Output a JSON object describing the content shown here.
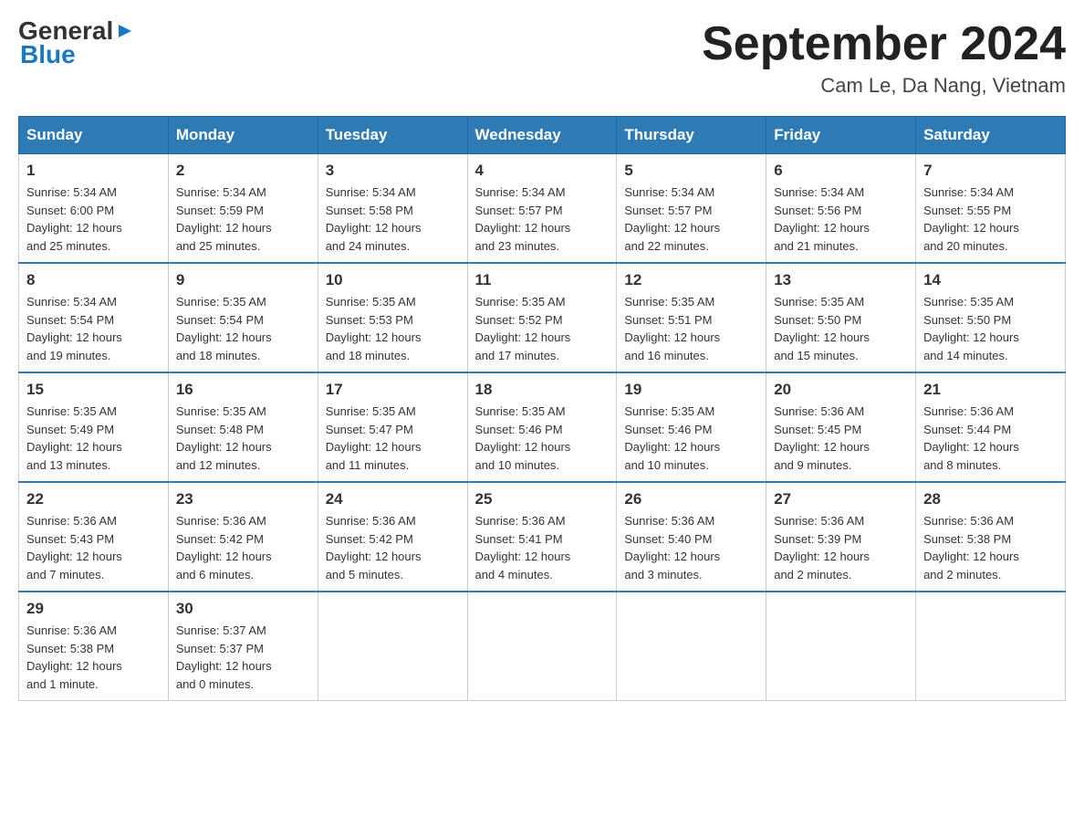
{
  "header": {
    "logo_general": "General",
    "logo_blue": "Blue",
    "month_title": "September 2024",
    "subtitle": "Cam Le, Da Nang, Vietnam"
  },
  "weekdays": [
    "Sunday",
    "Monday",
    "Tuesday",
    "Wednesday",
    "Thursday",
    "Friday",
    "Saturday"
  ],
  "weeks": [
    [
      {
        "day": "1",
        "info": "Sunrise: 5:34 AM\nSunset: 6:00 PM\nDaylight: 12 hours\nand 25 minutes."
      },
      {
        "day": "2",
        "info": "Sunrise: 5:34 AM\nSunset: 5:59 PM\nDaylight: 12 hours\nand 25 minutes."
      },
      {
        "day": "3",
        "info": "Sunrise: 5:34 AM\nSunset: 5:58 PM\nDaylight: 12 hours\nand 24 minutes."
      },
      {
        "day": "4",
        "info": "Sunrise: 5:34 AM\nSunset: 5:57 PM\nDaylight: 12 hours\nand 23 minutes."
      },
      {
        "day": "5",
        "info": "Sunrise: 5:34 AM\nSunset: 5:57 PM\nDaylight: 12 hours\nand 22 minutes."
      },
      {
        "day": "6",
        "info": "Sunrise: 5:34 AM\nSunset: 5:56 PM\nDaylight: 12 hours\nand 21 minutes."
      },
      {
        "day": "7",
        "info": "Sunrise: 5:34 AM\nSunset: 5:55 PM\nDaylight: 12 hours\nand 20 minutes."
      }
    ],
    [
      {
        "day": "8",
        "info": "Sunrise: 5:34 AM\nSunset: 5:54 PM\nDaylight: 12 hours\nand 19 minutes."
      },
      {
        "day": "9",
        "info": "Sunrise: 5:35 AM\nSunset: 5:54 PM\nDaylight: 12 hours\nand 18 minutes."
      },
      {
        "day": "10",
        "info": "Sunrise: 5:35 AM\nSunset: 5:53 PM\nDaylight: 12 hours\nand 18 minutes."
      },
      {
        "day": "11",
        "info": "Sunrise: 5:35 AM\nSunset: 5:52 PM\nDaylight: 12 hours\nand 17 minutes."
      },
      {
        "day": "12",
        "info": "Sunrise: 5:35 AM\nSunset: 5:51 PM\nDaylight: 12 hours\nand 16 minutes."
      },
      {
        "day": "13",
        "info": "Sunrise: 5:35 AM\nSunset: 5:50 PM\nDaylight: 12 hours\nand 15 minutes."
      },
      {
        "day": "14",
        "info": "Sunrise: 5:35 AM\nSunset: 5:50 PM\nDaylight: 12 hours\nand 14 minutes."
      }
    ],
    [
      {
        "day": "15",
        "info": "Sunrise: 5:35 AM\nSunset: 5:49 PM\nDaylight: 12 hours\nand 13 minutes."
      },
      {
        "day": "16",
        "info": "Sunrise: 5:35 AM\nSunset: 5:48 PM\nDaylight: 12 hours\nand 12 minutes."
      },
      {
        "day": "17",
        "info": "Sunrise: 5:35 AM\nSunset: 5:47 PM\nDaylight: 12 hours\nand 11 minutes."
      },
      {
        "day": "18",
        "info": "Sunrise: 5:35 AM\nSunset: 5:46 PM\nDaylight: 12 hours\nand 10 minutes."
      },
      {
        "day": "19",
        "info": "Sunrise: 5:35 AM\nSunset: 5:46 PM\nDaylight: 12 hours\nand 10 minutes."
      },
      {
        "day": "20",
        "info": "Sunrise: 5:36 AM\nSunset: 5:45 PM\nDaylight: 12 hours\nand 9 minutes."
      },
      {
        "day": "21",
        "info": "Sunrise: 5:36 AM\nSunset: 5:44 PM\nDaylight: 12 hours\nand 8 minutes."
      }
    ],
    [
      {
        "day": "22",
        "info": "Sunrise: 5:36 AM\nSunset: 5:43 PM\nDaylight: 12 hours\nand 7 minutes."
      },
      {
        "day": "23",
        "info": "Sunrise: 5:36 AM\nSunset: 5:42 PM\nDaylight: 12 hours\nand 6 minutes."
      },
      {
        "day": "24",
        "info": "Sunrise: 5:36 AM\nSunset: 5:42 PM\nDaylight: 12 hours\nand 5 minutes."
      },
      {
        "day": "25",
        "info": "Sunrise: 5:36 AM\nSunset: 5:41 PM\nDaylight: 12 hours\nand 4 minutes."
      },
      {
        "day": "26",
        "info": "Sunrise: 5:36 AM\nSunset: 5:40 PM\nDaylight: 12 hours\nand 3 minutes."
      },
      {
        "day": "27",
        "info": "Sunrise: 5:36 AM\nSunset: 5:39 PM\nDaylight: 12 hours\nand 2 minutes."
      },
      {
        "day": "28",
        "info": "Sunrise: 5:36 AM\nSunset: 5:38 PM\nDaylight: 12 hours\nand 2 minutes."
      }
    ],
    [
      {
        "day": "29",
        "info": "Sunrise: 5:36 AM\nSunset: 5:38 PM\nDaylight: 12 hours\nand 1 minute."
      },
      {
        "day": "30",
        "info": "Sunrise: 5:37 AM\nSunset: 5:37 PM\nDaylight: 12 hours\nand 0 minutes."
      },
      {
        "day": "",
        "info": ""
      },
      {
        "day": "",
        "info": ""
      },
      {
        "day": "",
        "info": ""
      },
      {
        "day": "",
        "info": ""
      },
      {
        "day": "",
        "info": ""
      }
    ]
  ]
}
